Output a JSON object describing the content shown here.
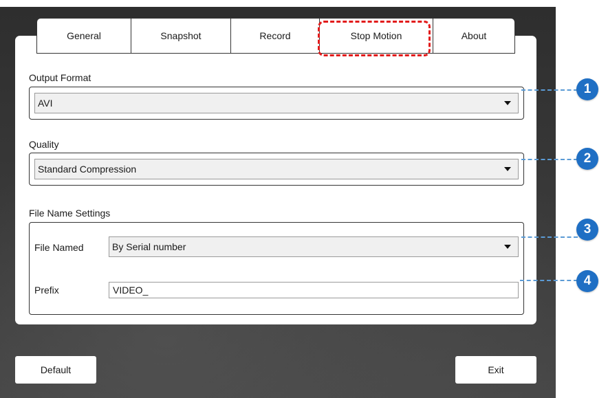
{
  "tabs": [
    {
      "label": "General",
      "selected": false
    },
    {
      "label": "Snapshot",
      "selected": false
    },
    {
      "label": "Record",
      "selected": false
    },
    {
      "label": "Stop Motion",
      "selected": true
    },
    {
      "label": "About",
      "selected": false
    }
  ],
  "output_format": {
    "label": "Output Format",
    "value": "AVI"
  },
  "quality": {
    "label": "Quality",
    "value": "Standard Compression"
  },
  "file_name_settings": {
    "label": "File Name Settings",
    "file_named_label": "File Named",
    "file_named_value": "By Serial number",
    "prefix_label": "Prefix",
    "prefix_value": "VIDEO_"
  },
  "buttons": {
    "default": "Default",
    "exit": "Exit"
  },
  "callouts": [
    "1",
    "2",
    "3",
    "4"
  ],
  "colors": {
    "highlight": "#e21b1b",
    "callout": "#1f6fc4",
    "callout_line": "#5b9bd5"
  }
}
